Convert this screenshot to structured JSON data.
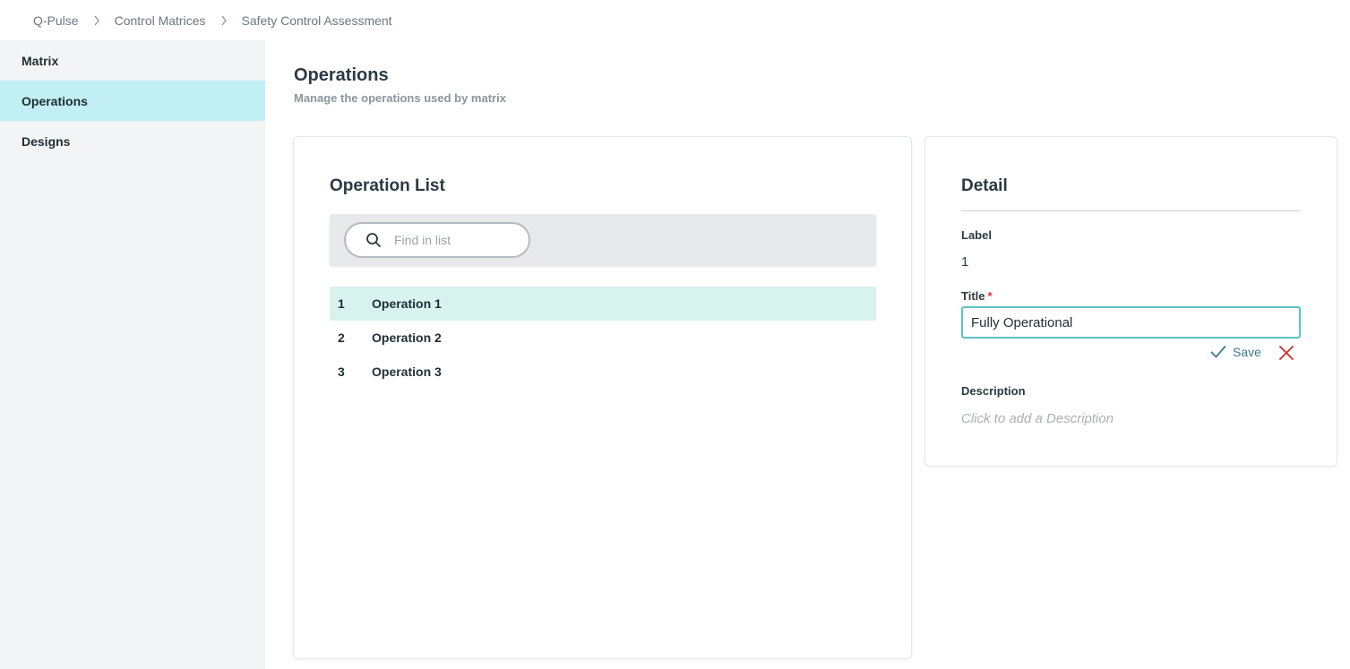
{
  "breadcrumb": {
    "items": [
      "Q-Pulse",
      "Control Matrices",
      "Safety Control Assessment"
    ]
  },
  "sidebar": {
    "items": [
      {
        "label": "Matrix",
        "active": false
      },
      {
        "label": "Operations",
        "active": true
      },
      {
        "label": "Designs",
        "active": false
      }
    ]
  },
  "header": {
    "title": "Operations",
    "subtitle": "Manage the operations used by matrix"
  },
  "operation_list": {
    "title": "Operation List",
    "search_placeholder": "Find in list",
    "search_value": "",
    "rows": [
      {
        "num": "1",
        "name": "Operation 1",
        "selected": true
      },
      {
        "num": "2",
        "name": "Operation 2",
        "selected": false
      },
      {
        "num": "3",
        "name": "Operation 3",
        "selected": false
      }
    ]
  },
  "detail": {
    "title": "Detail",
    "label_field_label": "Label",
    "label_value": "1",
    "title_field_label": "Title",
    "title_required_mark": "*",
    "title_value": "Fully Operational",
    "save_label": "Save",
    "description_label": "Description",
    "description_placeholder": "Click to add a Description"
  },
  "colors": {
    "sidebar_bg": "#f3f4f5",
    "sidebar_active": "#c2eff3",
    "selected_row": "#d8f2ee",
    "input_focus_border": "#5cc3c6",
    "save_color": "#3d7a8c",
    "cancel_color": "#d0312d"
  },
  "icons": {
    "breadcrumb_separator": "chevron-right-icon",
    "search": "search-icon",
    "save": "checkmark-icon",
    "cancel": "close-icon"
  }
}
